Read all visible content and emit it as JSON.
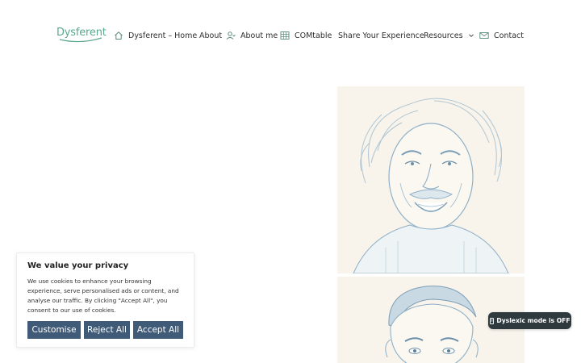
{
  "header": {
    "logo_text": "Dysferent",
    "nav": [
      {
        "label": "Dysferent – Home",
        "icon": "home-icon"
      },
      {
        "label": "About"
      },
      {
        "label": "About me",
        "icon": "user-icon"
      },
      {
        "label": "COMtable",
        "icon": "table-icon"
      },
      {
        "label": "Share Your Experience"
      },
      {
        "label": "Resources",
        "icon": "chevron-down-icon"
      },
      {
        "label": "Contact",
        "icon": "mail-icon"
      }
    ]
  },
  "cookie_banner": {
    "title": "We value your privacy",
    "body": "We use cookies to enhance your browsing experience, serve personalised ads or content, and analyse our traffic. By clicking \"Accept All\", you consent to our use of cookies.",
    "buttons": {
      "customise": "Customise",
      "reject": "Reject All",
      "accept": "Accept All"
    }
  },
  "dyslexic_toggle": {
    "icon": "pencil-icon",
    "label": "Dyslexic mode is OFF"
  },
  "colors": {
    "brand_green": "#5aa88f",
    "button_blue": "#3f5b78",
    "toggle_bg": "#2f3a3f",
    "sketch_blue": "#8fb0c7"
  }
}
